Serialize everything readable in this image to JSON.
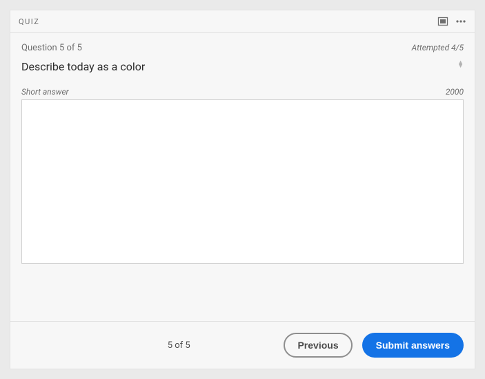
{
  "header": {
    "title": "QUIZ",
    "icons": {
      "fullscreen": "fullscreen-icon",
      "more": "more-icon"
    }
  },
  "meta": {
    "question_counter": "Question 5 of 5",
    "attempted": "Attempted 4/5"
  },
  "question": {
    "text": "Describe today as a color"
  },
  "answer": {
    "type_label": "Short answer",
    "char_limit": "2000",
    "value": ""
  },
  "footer": {
    "page_indicator": "5 of 5",
    "previous_label": "Previous",
    "submit_label": "Submit answers"
  }
}
